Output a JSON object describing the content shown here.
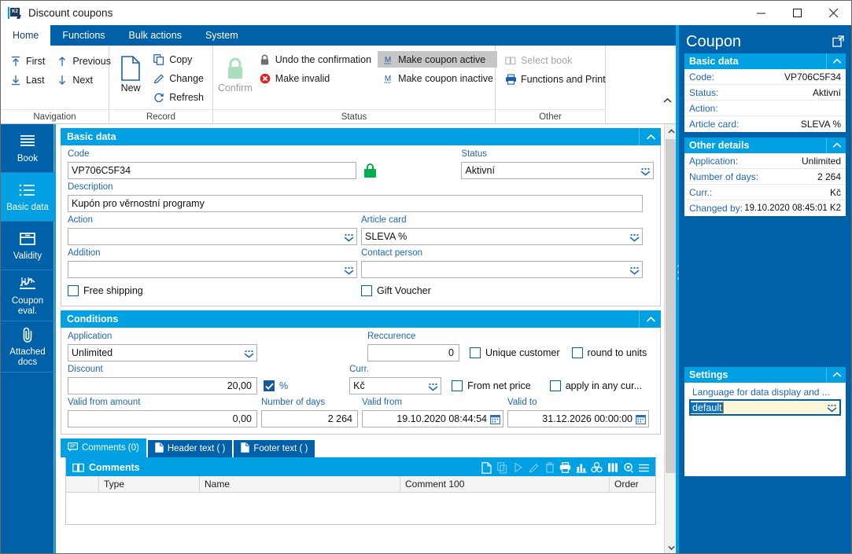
{
  "window": {
    "title": "Discount coupons",
    "logo_text": "K2",
    "minimize": "—",
    "maximize": "□",
    "close": "✕"
  },
  "ribbon": {
    "tabs": [
      {
        "label": "Home",
        "active": true
      },
      {
        "label": "Functions",
        "active": false
      },
      {
        "label": "Bulk actions",
        "active": false
      },
      {
        "label": "System",
        "active": false
      }
    ],
    "groups": [
      {
        "label": "Navigation",
        "buttons": [
          {
            "label": "First",
            "icon": "arrow-up-to-line-icon"
          },
          {
            "label": "Previous",
            "icon": "arrow-up-icon"
          },
          {
            "label": "Last",
            "icon": "arrow-down-to-line-icon"
          },
          {
            "label": "Next",
            "icon": "arrow-down-icon"
          }
        ]
      },
      {
        "label": "Record",
        "big": {
          "label": "New",
          "icon": "new-document-icon"
        },
        "buttons": [
          {
            "label": "Copy",
            "icon": "copy-icon"
          },
          {
            "label": "Change",
            "icon": "pencil-icon"
          },
          {
            "label": "Refresh",
            "icon": "refresh-icon"
          }
        ]
      },
      {
        "label": "Status",
        "big": {
          "label": "Confirm",
          "icon": "padlock-green-icon",
          "disabled": true
        },
        "buttons": [
          {
            "label": "Undo the confirmation",
            "icon": "padlock-gray-icon"
          },
          {
            "label": "Make invalid",
            "icon": "red-x-circle-icon"
          },
          {
            "label": "Make coupon active",
            "icon": "letter-m-icon",
            "selected": true
          },
          {
            "label": "Make coupon inactive",
            "icon": "letter-m-icon"
          }
        ]
      },
      {
        "label": "Other",
        "buttons": [
          {
            "label": "Select book",
            "icon": "book-icon",
            "disabled": true
          },
          {
            "label": "Functions and Print",
            "icon": "printer-icon"
          }
        ]
      }
    ],
    "collapse_icon": "chevron-up-icon"
  },
  "sidebar": {
    "items": [
      {
        "label": "Book",
        "icon": "book-lines-icon",
        "active": false
      },
      {
        "label": "Basic data",
        "icon": "list-icon",
        "active": true
      },
      {
        "label": "Validity",
        "icon": "box-icon",
        "active": false
      },
      {
        "label": "Coupon eval.",
        "icon": "chart-scatter-icon",
        "active": false
      },
      {
        "label": "Attached docs",
        "icon": "paperclip-icon",
        "active": false
      }
    ]
  },
  "main": {
    "basic_data": {
      "title": "Basic data",
      "code": {
        "label": "Code",
        "value": "VP706C5F34"
      },
      "lock_icon": "padlock-green-icon",
      "status": {
        "label": "Status",
        "value": "Aktivní"
      },
      "description": {
        "label": "Description",
        "value": "Kupón pro věrnostní programy"
      },
      "action": {
        "label": "Action",
        "value": ""
      },
      "article_card": {
        "label": "Article card",
        "value": "SLEVA %"
      },
      "addition": {
        "label": "Addition",
        "value": ""
      },
      "contact_person": {
        "label": "Contact person",
        "value": ""
      },
      "free_shipping": {
        "label": "Free shipping",
        "checked": false
      },
      "gift_voucher": {
        "label": "Gift Voucher",
        "checked": false
      }
    },
    "conditions": {
      "title": "Conditions",
      "application": {
        "label": "Application",
        "value": "Unlimited"
      },
      "reccurence": {
        "label": "Reccurence",
        "value": "0"
      },
      "unique_customer": {
        "label": "Unique customer",
        "checked": false
      },
      "round_to_units": {
        "label": "round to units",
        "checked": false
      },
      "discount": {
        "label": "Discount",
        "value": "20,00"
      },
      "percent": {
        "label": "%",
        "checked": true
      },
      "curr": {
        "label": "Curr.",
        "value": "Kč"
      },
      "from_net_price": {
        "label": "From net price",
        "checked": false
      },
      "apply_any_cur": {
        "label": "apply in any cur...",
        "checked": false
      },
      "valid_from_amount": {
        "label": "Valid from amount",
        "value": "0,00"
      },
      "number_of_days": {
        "label": "Number of days",
        "value": "2 264"
      },
      "valid_from": {
        "label": "Valid from",
        "value": "19.10.2020 08:44:54"
      },
      "valid_to": {
        "label": "Valid to",
        "value": "31.12.2026 00:00:00"
      }
    },
    "bottom_tabs": [
      {
        "label": "Comments (0)",
        "icon": "comment-icon",
        "active": true
      },
      {
        "label": "Header text ( )",
        "icon": "document-icon",
        "active": false
      },
      {
        "label": "Footer text ( )",
        "icon": "document-icon",
        "active": false
      }
    ],
    "comments_grid": {
      "title": "Comments",
      "title_icon": "book-open-icon",
      "tools": [
        {
          "icon": "new-record-icon",
          "disabled": false
        },
        {
          "icon": "copy-record-icon",
          "disabled": true
        },
        {
          "icon": "play-icon",
          "disabled": true
        },
        {
          "icon": "edit-pencil-icon",
          "disabled": true
        },
        {
          "icon": "delete-trash-icon",
          "disabled": true
        },
        {
          "icon": "print-icon",
          "disabled": false
        },
        {
          "icon": "bar-chart-icon",
          "disabled": false
        },
        {
          "icon": "molecule-icon",
          "disabled": false
        },
        {
          "icon": "columns-icon",
          "disabled": false
        },
        {
          "icon": "gear-icon",
          "disabled": false
        },
        {
          "icon": "hamburger-menu-icon",
          "disabled": false
        }
      ],
      "columns": [
        "Type",
        "Name",
        "Comment 100",
        "Order"
      ],
      "rows": []
    }
  },
  "right_panel": {
    "title": "Coupon",
    "popout_icon": "popout-icon",
    "cards": [
      {
        "title": "Basic data",
        "rows": [
          {
            "key": "Code:",
            "value": "VP706C5F34"
          },
          {
            "key": "Status:",
            "value": "Aktivní"
          },
          {
            "key": "Action:",
            "value": ""
          },
          {
            "key": "Article card:",
            "value": "SLEVA %"
          }
        ]
      },
      {
        "title": "Other details",
        "rows": [
          {
            "key": "Application:",
            "value": "Unlimited"
          },
          {
            "key": "Number of days:",
            "value": "2 264"
          },
          {
            "key": "Curr.:",
            "value": "Kč"
          },
          {
            "key": "Changed by:",
            "value": "19.10.2020 08:45:01 K2"
          }
        ]
      }
    ],
    "settings": {
      "title": "Settings",
      "label": "Language for data display and ...",
      "value": "default"
    }
  },
  "colors": {
    "ribbon_blue": "#0060a8",
    "accent_cyan": "#00a0e3",
    "label_blue": "#1f66b5",
    "green": "#00b050",
    "red": "#e02020"
  }
}
